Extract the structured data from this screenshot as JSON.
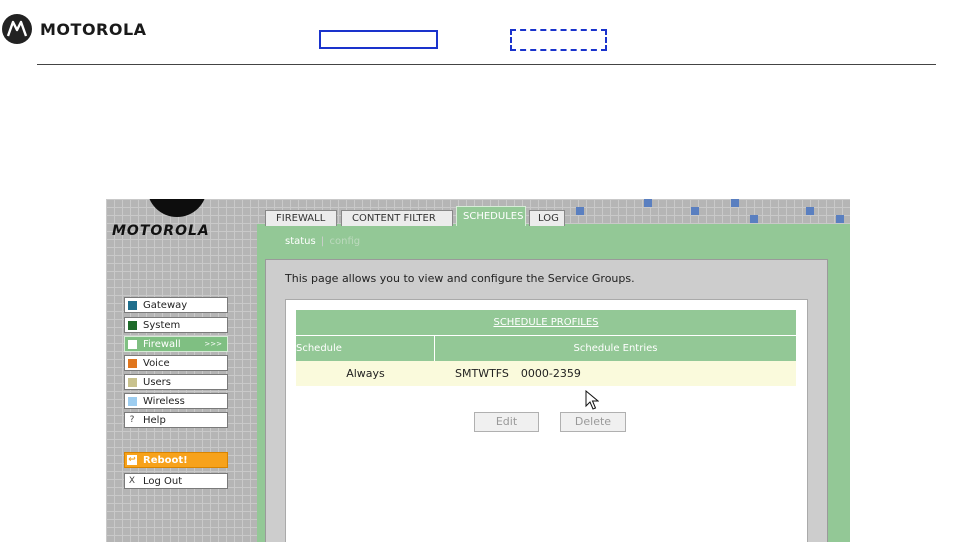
{
  "outer": {
    "brand": "MOTOROLA"
  },
  "router": {
    "brand": "MOTOROLA",
    "nav": {
      "gateway": "Gateway",
      "system": "System",
      "firewall": "Firewall",
      "firewall_arrows": ">>>",
      "voice": "Voice",
      "users": "Users",
      "wireless": "Wireless",
      "help": "Help",
      "reboot": "Reboot!",
      "logout": "Log Out"
    },
    "nav_colors": {
      "gateway": "#1f6e8c",
      "system": "#1e6b2a",
      "firewall": "#ffffff",
      "voice": "#e0761e",
      "users": "#c9c28e",
      "wireless": "#9dcdf0"
    },
    "tabs": {
      "firewall": "FIREWALL",
      "content_filter": "CONTENT FILTER",
      "schedules": "SCHEDULES",
      "log": "LOG"
    },
    "subnav": {
      "status": "status",
      "separator": "|",
      "config": "config"
    },
    "intro": "This page allows you to view and configure the Service Groups.",
    "table": {
      "title": "SCHEDULE PROFILES",
      "headers": [
        "Schedule",
        "Schedule Entries"
      ],
      "rows": [
        {
          "schedule": "Always",
          "days": "SMTWTFS",
          "time": "0000-2359"
        }
      ]
    },
    "buttons": {
      "edit": "Edit",
      "delete": "Delete"
    },
    "accent_green": "#93c896",
    "accent_orange": "#f7a21b"
  }
}
